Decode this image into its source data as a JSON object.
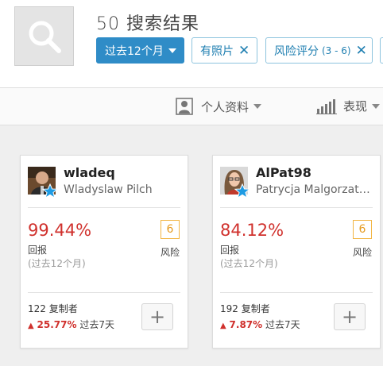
{
  "header": {
    "results_count": "50",
    "results_label": "搜索结果"
  },
  "filters": [
    {
      "label": "过去12个月",
      "active": true
    },
    {
      "label": "有照片"
    },
    {
      "label": "风险评分",
      "sub": "(3 - 6)"
    }
  ],
  "toolbar": {
    "profile_label": "个人资料",
    "performance_label": "表现"
  },
  "traders": [
    {
      "username": "wladeq",
      "full_name": "Wladyslaw Pilch",
      "return_pct": "99.44%",
      "return_label": "回报",
      "return_period": "(过去12个月)",
      "risk_score": "6",
      "risk_label": "风险",
      "copiers": "122 复制者",
      "gain_pct": "25.77%",
      "gain_period": "过去7天"
    },
    {
      "username": "AlPat98",
      "full_name": "Patrycja Malgorzat…",
      "return_pct": "84.12%",
      "return_label": "回报",
      "return_period": "(过去12个月)",
      "risk_score": "6",
      "risk_label": "风险",
      "copiers": "192 复制者",
      "gain_pct": "7.87%",
      "gain_period": "过去7天"
    }
  ],
  "colors": {
    "accent": "#2f8cc7",
    "return_red": "#d0312d",
    "risk_orange": "#f2b543",
    "star_blue": "#1e9be3"
  }
}
